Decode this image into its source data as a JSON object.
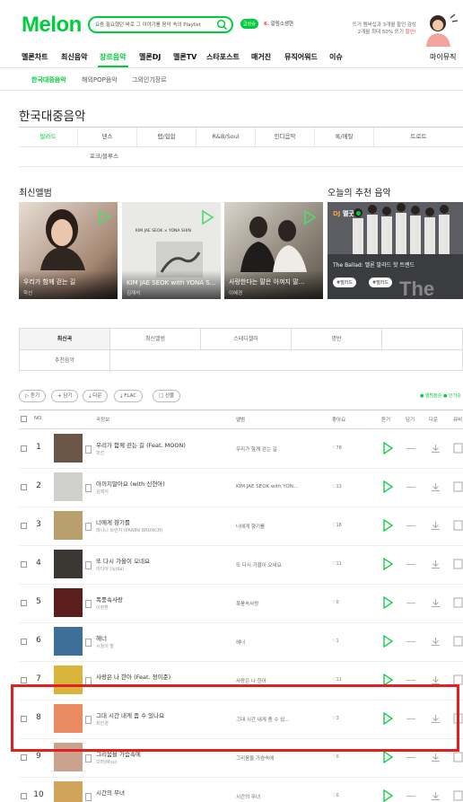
{
  "header": {
    "logo": "Melon",
    "search_placeholder": "요즘 필요했던 바로 그 이야기를 음악 속의 Playlist",
    "event_badge": "급상승",
    "event_num": "6.",
    "event_text": "알림소생현",
    "promo_line1": "뜨거 멤버십과 3개월 할인 감상",
    "promo_line2_pre": "2개월 최대 50% 뜨기 ",
    "promo_line2_hl": "할인!"
  },
  "gnb": [
    "멜론차트",
    "최신음악",
    "장르음악",
    "멜론DJ",
    "멜론TV",
    "스타포스트",
    "매거진",
    "뮤직어워드",
    "이슈",
    "마이뮤직"
  ],
  "subnav": [
    "한국대중음악",
    "해외POP음악",
    "그외인기장르"
  ],
  "page_title": "한국대중음악",
  "genres": [
    "발라드",
    "댄스",
    "랩/힙합",
    "R&B/Soul",
    "인디음악",
    "록/메탈",
    "트로트",
    "포크/블루스"
  ],
  "sections": {
    "new_albums": "최신앨범",
    "today_pick": "오늘의 추천 음악"
  },
  "albums": [
    {
      "title": "우리가 함께 걷는 길",
      "artist": "학선"
    },
    {
      "title": "KIM JAE SEOK with YONA S...",
      "artist": "김재석"
    },
    {
      "title": "사랑한다는 말은 아껴지 말...",
      "artist": "이혜경"
    }
  ],
  "dj_card": {
    "badge": "DJ",
    "name": "멜굿",
    "title": "The Ballad: 멜론 발라드 핫 트렌드",
    "tag1": "#발라드",
    "tag2": "#발라드"
  },
  "tabs": [
    "최신곡",
    "최신앨범",
    "스테디셀러",
    "명반",
    "추천음악"
  ],
  "tools": [
    "듣기",
    "담기",
    "다운",
    "FLAC",
    "선물"
  ],
  "tool_right": "● 앨범정순  ● 인기순",
  "thead": {
    "no": "NO",
    "song": "곡정보",
    "album": "앨범",
    "like": "좋아요",
    "listen": "듣기",
    "add": "담기",
    "download": "다운",
    "mv": "뮤비"
  },
  "rows": [
    {
      "rank": "1",
      "song": "우리가 함께 걷는 길 (Feat. MOON)",
      "artist": "학선",
      "album": "우리가 함께 걷는 길",
      "likes": "♡78",
      "thumb": "#6b5546"
    },
    {
      "rank": "2",
      "song": "아끼지말아요 (with 신현아)",
      "artist": "김재석",
      "album": "KIM JAE SEOK with YON...",
      "likes": "♡13",
      "thumb": "#cfcfcc"
    },
    {
      "rank": "3",
      "song": "너에게 향기를",
      "artist": "파니니 브런치 (PANINI BRUNCH)",
      "album": "너에게 향기를",
      "likes": "♡18",
      "thumb": "#b99f6d"
    },
    {
      "rank": "4",
      "song": "또 다시 가을이 오네요",
      "artist": "리디아 (lydia)",
      "album": "또 다시 가을이 오네요",
      "likes": "♡11",
      "thumb": "#3b3732"
    },
    {
      "rank": "5",
      "song": "폭풍속사랑",
      "artist": "이창환",
      "album": "폭풍속사랑",
      "likes": "♡0",
      "thumb": "#5b1e1c"
    },
    {
      "rank": "6",
      "song": "헤너",
      "artist": "시월의 말",
      "album": "헤너",
      "likes": "♡1",
      "thumb": "#3e6f98"
    },
    {
      "rank": "7",
      "song": "사랑은 나 한아 (Feat. 정이준)",
      "artist": "",
      "album": "사랑은 나 한아",
      "likes": "♡11",
      "thumb": "#d8b43a"
    },
    {
      "rank": "8",
      "song": "그대 시간 내게 좀 수 있나요",
      "artist": "최민경",
      "album": "그대 시간 내게 좀 수 있...",
      "likes": "♡3",
      "thumb": "#e98a62"
    },
    {
      "rank": "9",
      "song": "그리움을 가슴속에",
      "artist": "오마(Muu)",
      "album": "그리움을 가슴속에",
      "likes": "♡0",
      "thumb": "#c9a38e"
    },
    {
      "rank": "10",
      "song": "시간의 무녀",
      "artist": "",
      "album": "시간의 무녀",
      "likes": "♡0",
      "thumb": "#d1a45b"
    }
  ],
  "colors": {
    "brand": "#00cd3c",
    "highlight": "#e41e22"
  }
}
